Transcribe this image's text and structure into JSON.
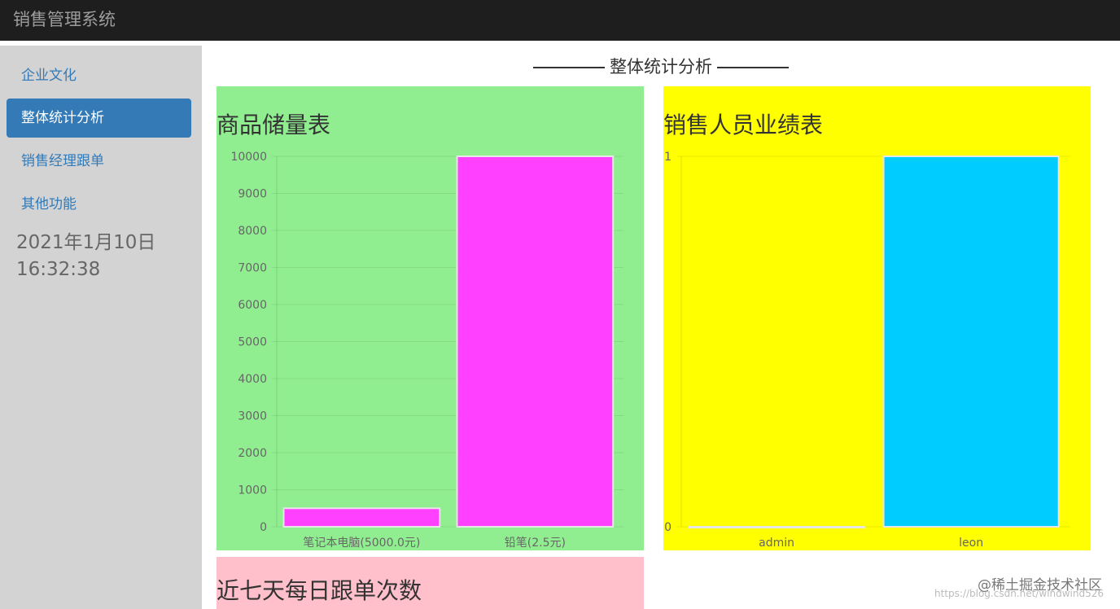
{
  "app": {
    "title": "销售管理系统"
  },
  "sidebar": {
    "items": [
      {
        "label": "企业文化",
        "active": false
      },
      {
        "label": "整体统计分析",
        "active": true
      },
      {
        "label": "销售经理跟单",
        "active": false
      },
      {
        "label": "其他功能",
        "active": false
      }
    ],
    "date": "2021年1月10日",
    "time": "16:32:38"
  },
  "main": {
    "section_title": "整体统计分析",
    "panels": {
      "stock": {
        "title": "商品储量表",
        "background": "#90ee90"
      },
      "sales": {
        "title": "销售人员业绩表",
        "background": "#ffff00"
      },
      "follow": {
        "title": "近七天每日跟单次数",
        "background": "#ffc0cb"
      }
    }
  },
  "chart_data": [
    {
      "type": "bar",
      "title": "商品储量表",
      "categories": [
        "笔记本电脑(5000.0元)",
        "铅笔(2.5元)"
      ],
      "values": [
        500,
        10000
      ],
      "ylim": [
        0,
        10000
      ],
      "yticks": [
        0,
        1000,
        2000,
        3000,
        4000,
        5000,
        6000,
        7000,
        8000,
        9000,
        10000
      ],
      "bar_color": "#ff40ff",
      "grid": true
    },
    {
      "type": "bar",
      "title": "销售人员业绩表",
      "categories": [
        "admin",
        "leon"
      ],
      "values": [
        0,
        1
      ],
      "ylim": [
        0,
        1
      ],
      "yticks": [
        0,
        1
      ],
      "bar_color": "#00ccff",
      "grid": true
    }
  ],
  "watermark": {
    "text": "@稀土掘金技术社区",
    "faint": "https://blog.csdn.net/windwind526"
  }
}
